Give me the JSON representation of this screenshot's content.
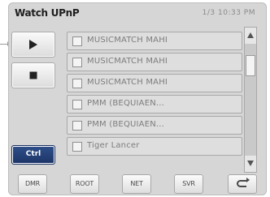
{
  "window": {
    "title": "Watch UPnP",
    "clock": "1/3 10:33 PM"
  },
  "controls": {
    "play_icon": "play-icon",
    "stop_icon": "stop-icon",
    "ctrl_label": "Ctrl"
  },
  "file_list": {
    "items": [
      {
        "label": "MUSICMATCH MAHI",
        "checked": false
      },
      {
        "label": "MUSICMATCH MAHI",
        "checked": false
      },
      {
        "label": "MUSICMATCH MAHI",
        "checked": false
      },
      {
        "label": "PMM (BEQUIAEN...",
        "checked": false
      },
      {
        "label": "PMM (BEQUIAEN...",
        "checked": false
      },
      {
        "label": "Tiger Lancer",
        "checked": false
      }
    ]
  },
  "toolbar": {
    "items": [
      {
        "label": "DMR",
        "icon": "dmr-icon"
      },
      {
        "label": "ROOT",
        "icon": "root-icon"
      },
      {
        "label": "NET",
        "icon": "network-icon"
      },
      {
        "label": "SVR",
        "icon": "server-icon"
      },
      {
        "label": "",
        "icon": "back-icon"
      }
    ]
  },
  "colors": {
    "ctrl_button": "#1c3566",
    "background": "#d6d6d6"
  }
}
